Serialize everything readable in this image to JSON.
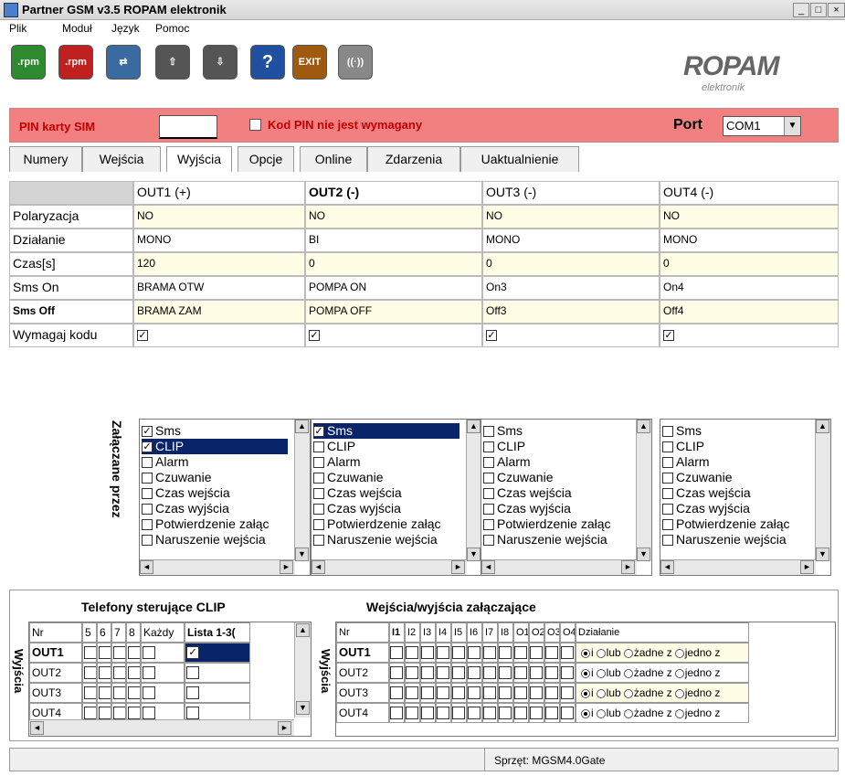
{
  "window": {
    "title": "Partner GSM v3.5 ROPAM elektronik",
    "min": "_",
    "max": "□",
    "close": "×"
  },
  "menu": [
    "Plik",
    "Moduł",
    "Język",
    "Pomoc"
  ],
  "toolbar": {
    "open_label": ".rpm",
    "save_label": ".rpm",
    "exit_label": "EXIT"
  },
  "logo": {
    "text": "ROPAM",
    "sub": "elektronik"
  },
  "pin": {
    "label": "PIN karty SIM",
    "value": "",
    "checkbox_label": "Kod PIN nie jest wymagany",
    "port_label": "Port",
    "port_value": "COM1"
  },
  "tabs": [
    "Numery",
    "Wejścia",
    "Wyjścia",
    "Opcje",
    "Online",
    "Zdarzenia",
    "Uaktualnienie"
  ],
  "active_tab": "Wyjścia",
  "outputs": {
    "columns": [
      "OUT1 (+)",
      "OUT2 (-)",
      "OUT3  (-)",
      "OUT4 (-)"
    ],
    "rows": [
      {
        "label": "Polaryzacja",
        "values": [
          "NO",
          "NO",
          "NO",
          "NO"
        ]
      },
      {
        "label": "Działanie",
        "values": [
          "MONO",
          "BI",
          "MONO",
          "MONO"
        ]
      },
      {
        "label": "Czas[s]",
        "values": [
          "120",
          "0",
          "0",
          "0"
        ]
      },
      {
        "label": "Sms On",
        "values": [
          "BRAMA OTW",
          "POMPA ON",
          "On3",
          "On4"
        ]
      },
      {
        "label": "Sms Off",
        "values": [
          "BRAMA ZAM",
          "POMPA OFF",
          "Off3",
          "Off4"
        ]
      },
      {
        "label": "Wymagaj kodu",
        "values": [
          "✓",
          "✓",
          "✓",
          "✓"
        ]
      }
    ]
  },
  "zalaczane": {
    "label": "Załączane przez",
    "items": [
      "Sms",
      "CLIP",
      "Alarm",
      "Czuwanie",
      "Czas wejścia",
      "Czas wyjścia",
      "Potwierdzenie załąc",
      "Naruszenie wejścia"
    ],
    "lists": [
      {
        "checked": [
          true,
          true,
          false,
          false,
          false,
          false,
          false,
          false
        ],
        "selected": 1
      },
      {
        "checked": [
          true,
          false,
          false,
          false,
          false,
          false,
          false,
          false
        ],
        "selected": 0
      },
      {
        "checked": [
          false,
          false,
          false,
          false,
          false,
          false,
          false,
          false
        ],
        "selected": -1
      },
      {
        "checked": [
          false,
          false,
          false,
          false,
          false,
          false,
          false,
          false
        ],
        "selected": -1
      }
    ]
  },
  "clip": {
    "title": "Telefony sterujące CLIP",
    "side_label": "Wyjścia",
    "headers": [
      "Nr",
      "5",
      "6",
      "7",
      "8",
      "Każdy",
      "Lista 1-3("
    ],
    "rows": [
      "OUT1",
      "OUT2",
      "OUT3",
      "OUT4"
    ]
  },
  "io": {
    "title": "Wejścia/wyjścia załączające",
    "side_label": "Wyjścia",
    "headers": [
      "Nr",
      "I1",
      "I2",
      "I3",
      "I4",
      "I5",
      "I6",
      "I7",
      "I8",
      "O1",
      "O2",
      "O3",
      "O4",
      "Działanie"
    ],
    "rows": [
      "OUT1",
      "OUT2",
      "OUT3",
      "OUT4"
    ],
    "action_options": [
      "i",
      "lub",
      "żadne z",
      "jedno z"
    ]
  },
  "status": {
    "hardware": "Sprzęt: MGSM4.0Gate"
  }
}
